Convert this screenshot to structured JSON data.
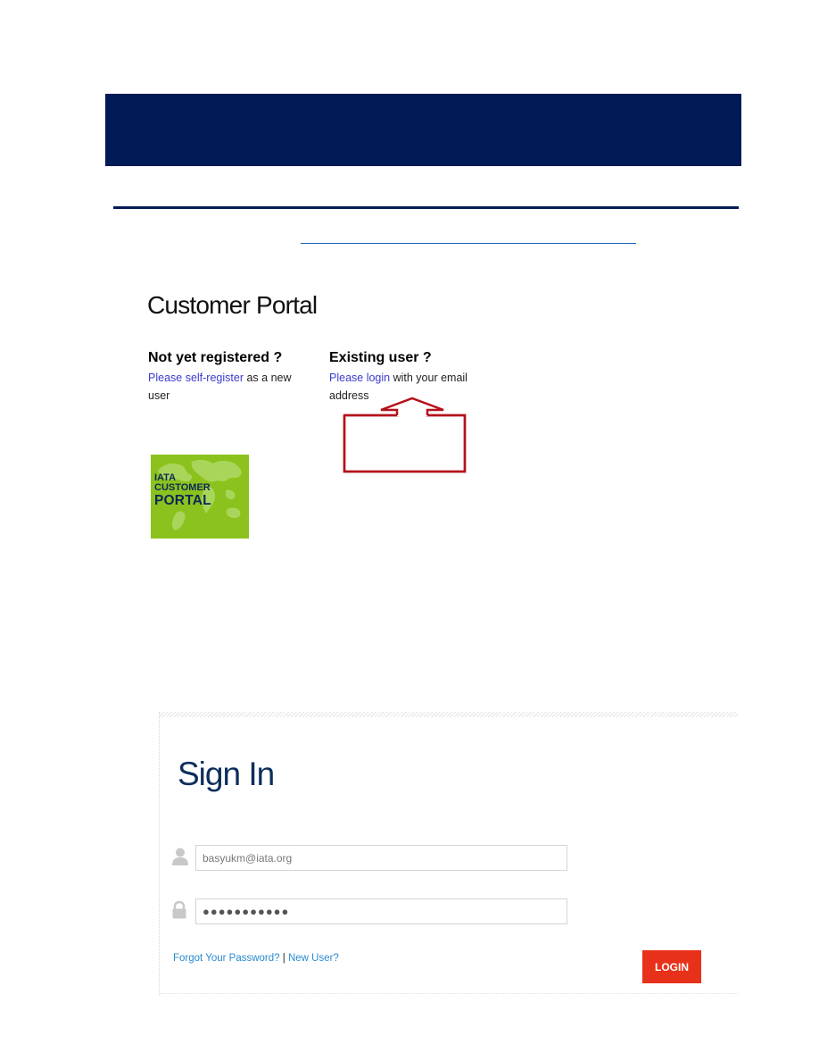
{
  "portal": {
    "title": "Customer Portal",
    "not_registered": {
      "heading": "Not yet registered ?",
      "link_text": "Please self-register",
      "rest_text": " as a new user"
    },
    "existing": {
      "heading": "Existing user ?",
      "link_text": "Please login",
      "rest_text": " with your email address"
    },
    "logo": {
      "line1": "IATA",
      "line2": "CUSTOMER",
      "line3": "PORTAL"
    }
  },
  "signin": {
    "title": "Sign In",
    "username_value": "basyukm@iata.org",
    "password_value": "●●●●●●●●●●●",
    "forgot_link": "Forgot Your Password?",
    "separator": " | ",
    "new_user_link": "New User?",
    "login_button": "LOGIN"
  },
  "colors": {
    "banner": "#001a55",
    "logo_green": "#8cc21d",
    "login_button": "#e8311a",
    "callout_arrow": "#b3121b",
    "link": "#3b3bd1"
  },
  "icons": [
    "user-icon",
    "lock-icon",
    "up-arrow-icon",
    "world-map-icon"
  ]
}
